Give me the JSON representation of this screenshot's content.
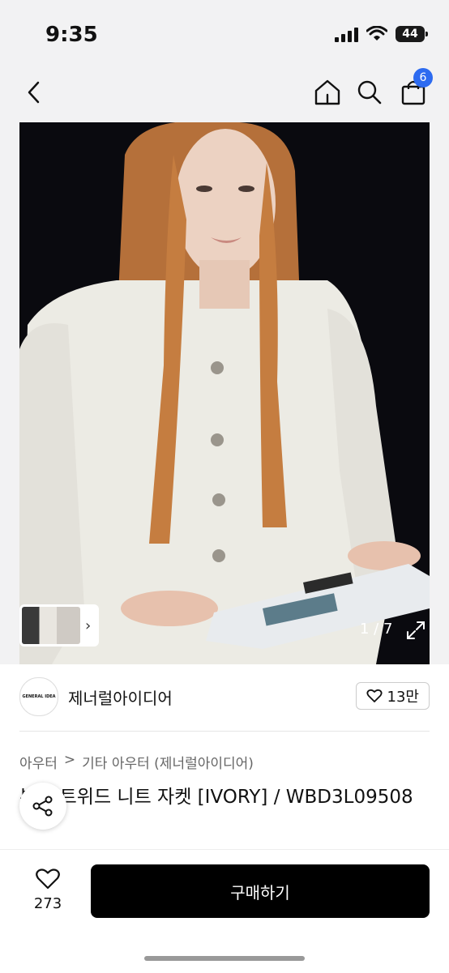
{
  "status_bar": {
    "time": "9:35",
    "battery": "44"
  },
  "nav": {
    "cart_count": "6"
  },
  "gallery": {
    "counter": "1 / 7"
  },
  "brand": {
    "logo_text": "GENERAL IDEA",
    "name": "제너럴아이디어",
    "likes": "13만"
  },
  "breadcrumb": {
    "level1": "아우터",
    "separator": ">",
    "level2": "기타 아우터 (제너럴아이디어)"
  },
  "product": {
    "title": "부클 트위드 니트 자켓 [IVORY] / WBD3L09508"
  },
  "bottom_bar": {
    "wish_count": "273",
    "buy_label": "구매하기"
  }
}
